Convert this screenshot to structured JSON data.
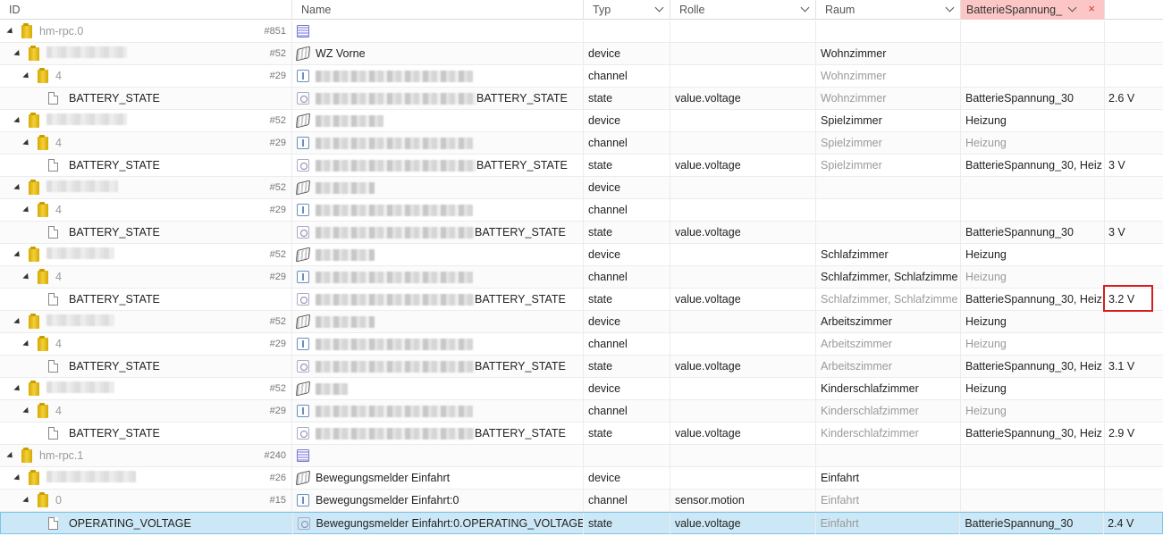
{
  "header": {
    "id": "ID",
    "name": "Name",
    "type": "Typ",
    "role": "Rolle",
    "room": "Raum",
    "function": "BatterieSpannung_",
    "close_symbol": "×"
  },
  "rows": [
    {
      "id": "hm-rpc.0",
      "num": "#851",
      "type": "",
      "role": "",
      "room": "",
      "func": "",
      "value": ""
    },
    {
      "id": "MEQ0797352",
      "num": "#52",
      "name": "WZ Vorne",
      "type": "device",
      "role": "",
      "room": "Wohnzimmer",
      "func": "",
      "value": ""
    },
    {
      "id": "4",
      "num": "#29",
      "name_suffix": "",
      "type": "channel",
      "role": "",
      "room": "Wohnzimmer",
      "func": "",
      "value": ""
    },
    {
      "id": "BATTERY_STATE",
      "name_suffix": "BATTERY_STATE",
      "type": "state",
      "role": "value.voltage",
      "room": "Wohnzimmer",
      "func": "BatterieSpannung_30",
      "value": "2.6 V"
    },
    {
      "id": "",
      "num": "#52",
      "type": "device",
      "role": "",
      "room": "Spielzimmer",
      "func": "Heizung",
      "value": ""
    },
    {
      "id": "4",
      "num": "#29",
      "type": "channel",
      "role": "",
      "room": "Spielzimmer",
      "func": "Heizung",
      "value": ""
    },
    {
      "id": "BATTERY_STATE",
      "name_suffix": "BATTERY_STATE",
      "type": "state",
      "role": "value.voltage",
      "room": "Spielzimmer",
      "func": "BatterieSpannung_30, Heiz",
      "value": "3 V"
    },
    {
      "id": "",
      "num": "#52",
      "type": "device",
      "role": "",
      "room": "",
      "func": "",
      "value": ""
    },
    {
      "id": "4",
      "num": "#29",
      "type": "channel",
      "role": "",
      "room": "",
      "func": "",
      "value": ""
    },
    {
      "id": "BATTERY_STATE",
      "name_suffix": "BATTERY_STATE",
      "type": "state",
      "role": "value.voltage",
      "room": "",
      "func": "BatterieSpannung_30",
      "value": "3 V"
    },
    {
      "id": "",
      "num": "#52",
      "type": "device",
      "role": "",
      "room": "Schlafzimmer",
      "func": "Heizung",
      "value": ""
    },
    {
      "id": "4",
      "num": "#29",
      "type": "channel",
      "role": "",
      "room": "Schlafzimmer, Schlafzimme",
      "func": "Heizung",
      "value": ""
    },
    {
      "id": "BATTERY_STATE",
      "name_suffix": "BATTERY_STATE",
      "type": "state",
      "role": "value.voltage",
      "room": "Schlafzimmer, Schlafzimme",
      "func": "BatterieSpannung_30, Heiz",
      "value": "3.2 V"
    },
    {
      "id": "",
      "num": "#52",
      "type": "device",
      "role": "",
      "room": "Arbeitszimmer",
      "func": "Heizung",
      "value": ""
    },
    {
      "id": "4",
      "num": "#29",
      "type": "channel",
      "role": "",
      "room": "Arbeitszimmer",
      "func": "Heizung",
      "value": ""
    },
    {
      "id": "BATTERY_STATE",
      "name_suffix": "BATTERY_STATE",
      "type": "state",
      "role": "value.voltage",
      "room": "Arbeitszimmer",
      "func": "BatterieSpannung_30, Heiz",
      "value": "3.1 V"
    },
    {
      "id": "",
      "num": "#52",
      "type": "device",
      "role": "",
      "room": "Kinderschlafzimmer",
      "func": "Heizung",
      "value": ""
    },
    {
      "id": "4",
      "num": "#29",
      "type": "channel",
      "role": "",
      "room": "Kinderschlafzimmer",
      "func": "Heizung",
      "value": ""
    },
    {
      "id": "BATTERY_STATE",
      "name_suffix": "BATTERY_STATE",
      "type": "state",
      "role": "value.voltage",
      "room": "Kinderschlafzimmer",
      "func": "BatterieSpannung_30, Heiz",
      "value": "2.9 V"
    },
    {
      "id": "hm-rpc.1",
      "num": "#240",
      "type": "",
      "role": "",
      "room": "",
      "func": "",
      "value": ""
    },
    {
      "id": "",
      "num": "#26",
      "name": "Bewegungsmelder Einfahrt",
      "type": "device",
      "role": "",
      "room": "Einfahrt",
      "func": "",
      "value": ""
    },
    {
      "id": "0",
      "num": "#15",
      "name": "Bewegungsmelder Einfahrt:0",
      "type": "channel",
      "role": "sensor.motion",
      "room": "Einfahrt",
      "func": "",
      "value": ""
    },
    {
      "id": "OPERATING_VOLTAGE",
      "name": "Bewegungsmelder Einfahrt:0.OPERATING_VOLTAGE",
      "type": "state",
      "role": "value.voltage",
      "room": "Einfahrt",
      "func": "BatterieSpannung_30",
      "value": "2.4 V"
    }
  ]
}
